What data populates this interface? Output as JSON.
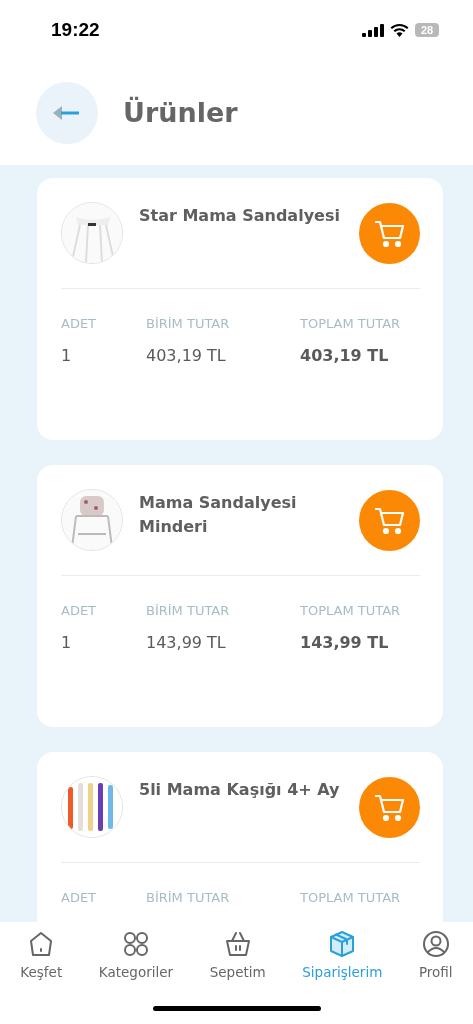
{
  "status_bar": {
    "time": "19:22",
    "battery": "28"
  },
  "header": {
    "title": "Ürünler"
  },
  "products": [
    {
      "name": "Star Mama Sandalyesi",
      "columns": [
        {
          "label": "ADET",
          "value": "1"
        },
        {
          "label": "BİRİM TUTAR",
          "value": "403,19 TL"
        },
        {
          "label": "TOPLAM TUTAR",
          "value": "403,19 TL"
        }
      ]
    },
    {
      "name": "Mama Sandalyesi Minderi",
      "columns": [
        {
          "label": "ADET",
          "value": "1"
        },
        {
          "label": "BİRİM TUTAR",
          "value": "143,99 TL"
        },
        {
          "label": "TOPLAM TUTAR",
          "value": "143,99 TL"
        }
      ]
    },
    {
      "name": "5li Mama Kaşığı 4+ Ay",
      "columns": [
        {
          "label": "ADET"
        },
        {
          "label": "BİRİM TUTAR"
        },
        {
          "label": "TOPLAM TUTAR"
        }
      ]
    }
  ],
  "tab_bar": [
    {
      "label": "Keşfet",
      "selected": false
    },
    {
      "label": "Kategoriler",
      "selected": false
    },
    {
      "label": "Sepetim",
      "selected": false
    },
    {
      "label": "Siparişlerim",
      "selected": true
    },
    {
      "label": "Profil",
      "selected": false
    }
  ]
}
